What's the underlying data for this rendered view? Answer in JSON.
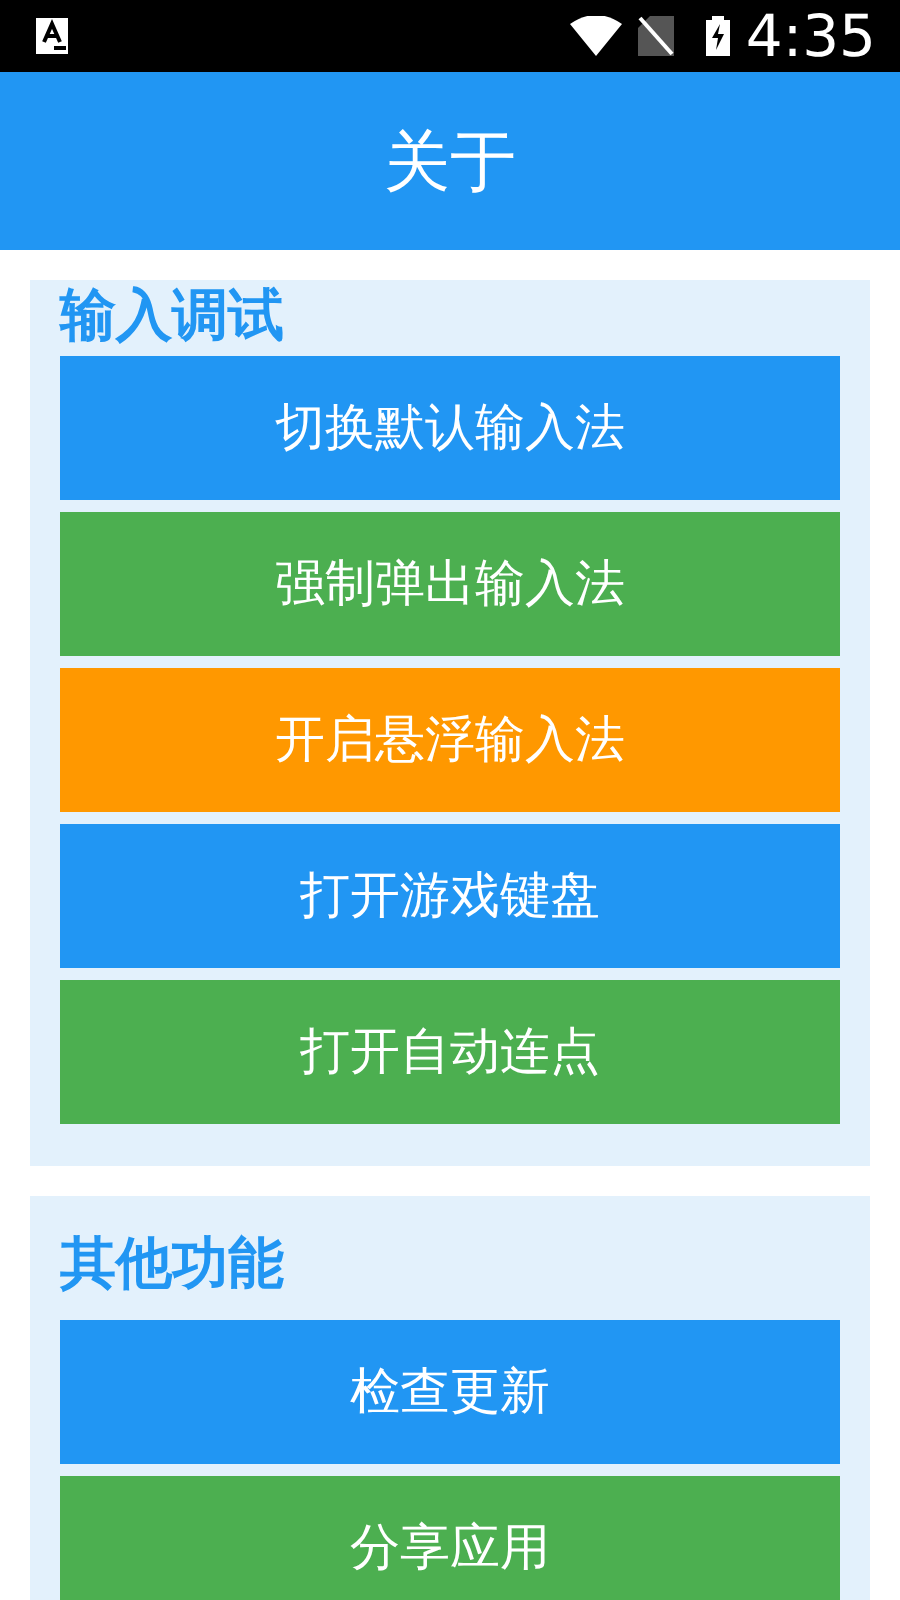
{
  "status_bar": {
    "time": "4:35"
  },
  "app_bar": {
    "title": "关于"
  },
  "sections": [
    {
      "title": "输入调试",
      "buttons": [
        {
          "label": "切换默认输入法",
          "color": "#2196f3"
        },
        {
          "label": "强制弹出输入法",
          "color": "#4caf50"
        },
        {
          "label": "开启悬浮输入法",
          "color": "#ff9800"
        },
        {
          "label": "打开游戏键盘",
          "color": "#2196f3"
        },
        {
          "label": "打开自动连点",
          "color": "#4caf50"
        }
      ]
    },
    {
      "title": "其他功能",
      "buttons": [
        {
          "label": "检查更新",
          "color": "#2196f3"
        },
        {
          "label": "分享应用",
          "color": "#4caf50"
        }
      ]
    }
  ]
}
